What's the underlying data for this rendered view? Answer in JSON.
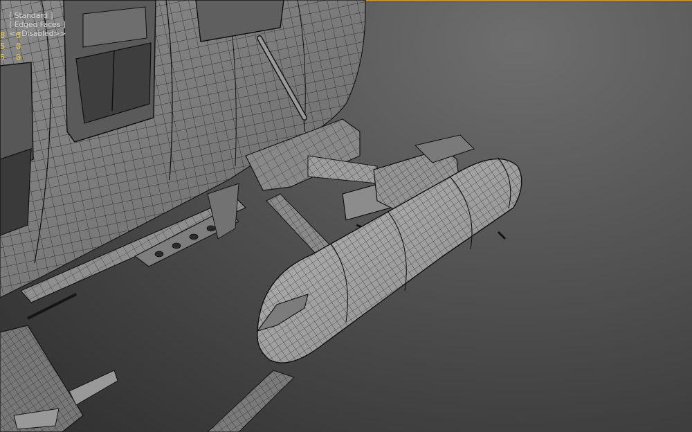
{
  "viewport": {
    "shading_mode": "[ Standard ]",
    "display_mode": "[ Edged Faces ]",
    "extra": "<<Disabled>>"
  },
  "stats": [
    {
      "a": "8",
      "b": "0"
    },
    {
      "a": "5",
      "b": "0"
    },
    {
      "a": "5",
      "b": "0"
    }
  ],
  "colors": {
    "stats_text": "#e6c84a",
    "active_border": "#d7a21a",
    "wire": "#151515"
  }
}
